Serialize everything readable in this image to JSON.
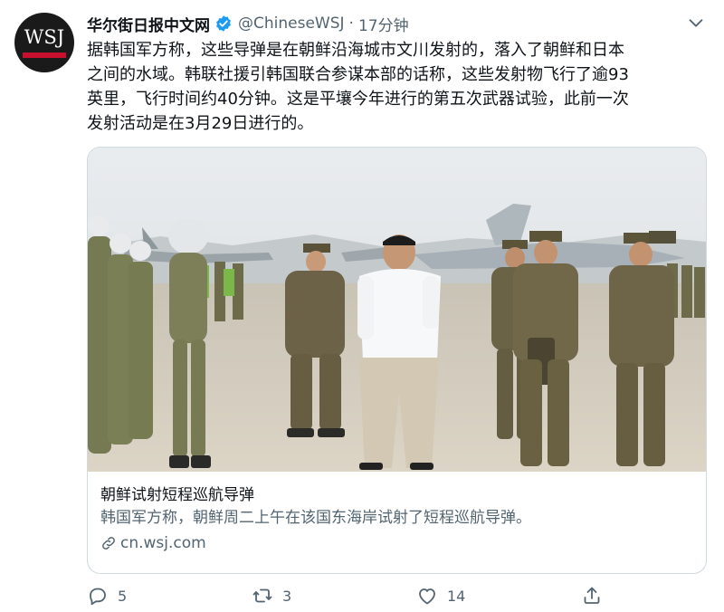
{
  "tweet": {
    "avatar_label": "WSJ",
    "display_name": "华尔街日报中文网",
    "handle": "@ChineseWSJ",
    "separator": "·",
    "time": "17分钟",
    "body_lines": [
      "据韩国军方称，这些导弹是在朝鲜沿海城市文川发射的，落入了朝鲜和日本",
      "之间的水域。韩联社援引韩国联合参谋本部的话称，这些发射物飞行了逾93",
      "英里，飞行时间约40分钟。这是平壤今年进行的第五次武器试验，此前一次",
      "发射活动是在3月29日进行的。"
    ]
  },
  "card": {
    "title": "朝鲜试射短程巡航导弹",
    "description": "韩国军方称，朝鲜周二上午在该国东海岸试射了短程巡航导弹。",
    "domain": "cn.wsj.com"
  },
  "actions": {
    "reply_count": "5",
    "retweet_count": "3",
    "like_count": "14"
  },
  "colors": {
    "verified": "#1d9bf0",
    "muted": "#536471",
    "border": "#cfd9de",
    "brand_red": "#c8102e"
  }
}
